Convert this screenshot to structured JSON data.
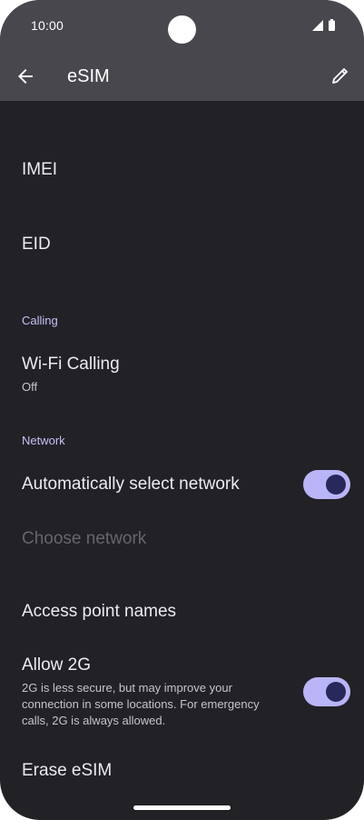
{
  "status_bar": {
    "time": "10:00"
  },
  "app_bar": {
    "title": "eSIM",
    "back_icon": "arrow-back-icon",
    "edit_icon": "pencil-icon"
  },
  "rows": {
    "imei": {
      "title": "IMEI"
    },
    "eid": {
      "title": "EID"
    },
    "calling_header": "Calling",
    "wifi_calling": {
      "title": "Wi-Fi Calling",
      "summary": "Off"
    },
    "network_header": "Network",
    "auto_select": {
      "title": "Automatically select network",
      "enabled": true
    },
    "choose_network": {
      "title": "Choose network",
      "disabled": true
    },
    "apn": {
      "title": "Access point names"
    },
    "allow_2g": {
      "title": "Allow 2G",
      "summary": "2G is less secure, but may improve your connection in some locations. For emergency calls, 2G is always allowed.",
      "enabled": true
    },
    "erase": {
      "title": "Erase eSIM"
    }
  },
  "colors": {
    "background": "#222126",
    "app_bar": "#48474d",
    "accent_header": "#c4c1f5",
    "toggle_track": "#b9b5f6",
    "toggle_thumb": "#29285b"
  }
}
